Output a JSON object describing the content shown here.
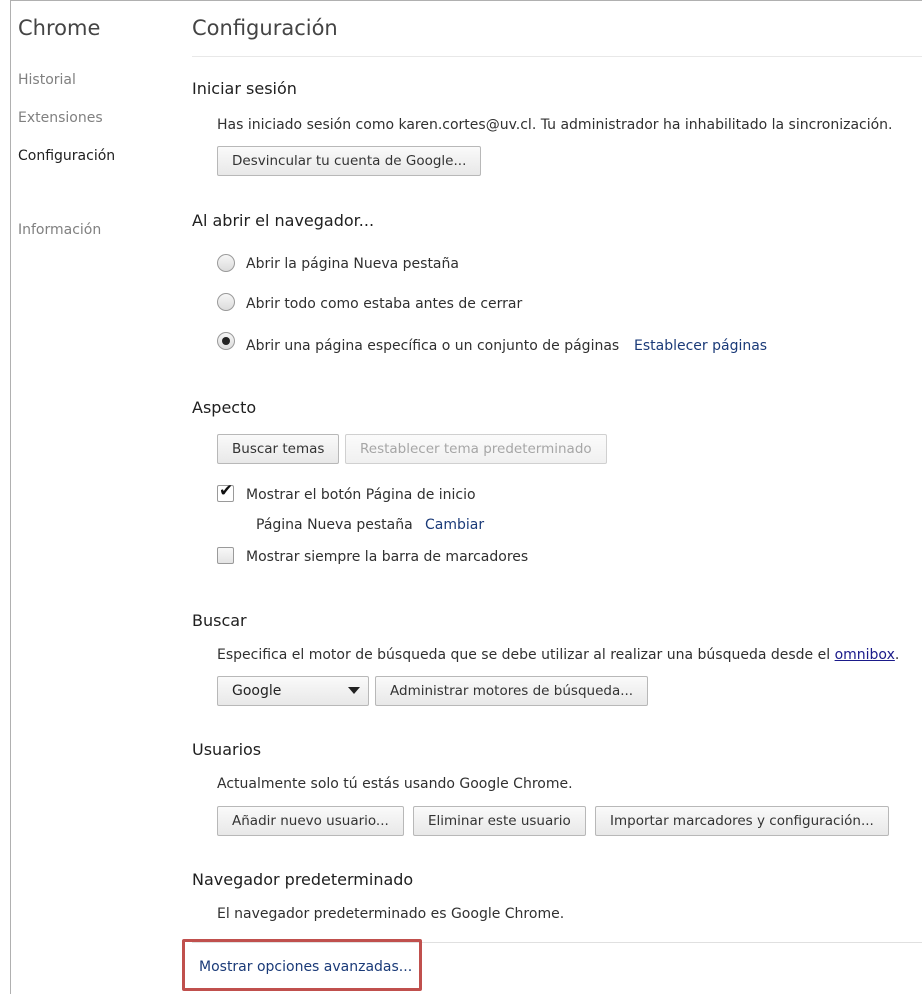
{
  "sidebar": {
    "app_title": "Chrome",
    "items": [
      {
        "label": "Historial",
        "selected": false
      },
      {
        "label": "Extensiones",
        "selected": false
      },
      {
        "label": "Configuración",
        "selected": true
      },
      {
        "label": "Información",
        "selected": false
      }
    ]
  },
  "main": {
    "title": "Configuración",
    "signin": {
      "title": "Iniciar sesión",
      "description": "Has iniciado sesión como karen.cortes@uv.cl. Tu administrador ha inhabilitado la sincronización.",
      "disconnect_button": "Desvincular tu cuenta de Google..."
    },
    "startup": {
      "title": "Al abrir el navegador...",
      "options": [
        {
          "label": "Abrir la página Nueva pestaña",
          "checked": false
        },
        {
          "label": "Abrir todo como estaba antes de cerrar",
          "checked": false
        },
        {
          "label": "Abrir una página específica o un conjunto de páginas",
          "checked": true
        }
      ],
      "set_pages_link": "Establecer páginas"
    },
    "appearance": {
      "title": "Aspecto",
      "get_themes_button": "Buscar temas",
      "reset_theme_button": "Restablecer tema predeterminado",
      "show_home_button_label": "Mostrar el botón Página de inicio",
      "show_home_button_checked": true,
      "home_page_value": "Página Nueva pestaña",
      "change_link": "Cambiar",
      "show_bookmarks_bar_label": "Mostrar siempre la barra de marcadores",
      "show_bookmarks_bar_checked": false
    },
    "search": {
      "title": "Buscar",
      "description": "Especifica el motor de búsqueda que se debe utilizar al realizar una búsqueda desde el",
      "omnibox_link": "omnibox",
      "description_end": ".",
      "engine_selected": "Google",
      "manage_button": "Administrar motores de búsqueda..."
    },
    "users": {
      "title": "Usuarios",
      "description": "Actualmente solo tú estás usando Google Chrome.",
      "add_button": "Añadir nuevo usuario...",
      "delete_button": "Eliminar este usuario",
      "import_button": "Importar marcadores y configuración..."
    },
    "default_browser": {
      "title": "Navegador predeterminado",
      "description": "El navegador predeterminado es Google Chrome."
    },
    "advanced_link": "Mostrar opciones avanzadas...",
    "highlight_color": "#c0504d"
  }
}
